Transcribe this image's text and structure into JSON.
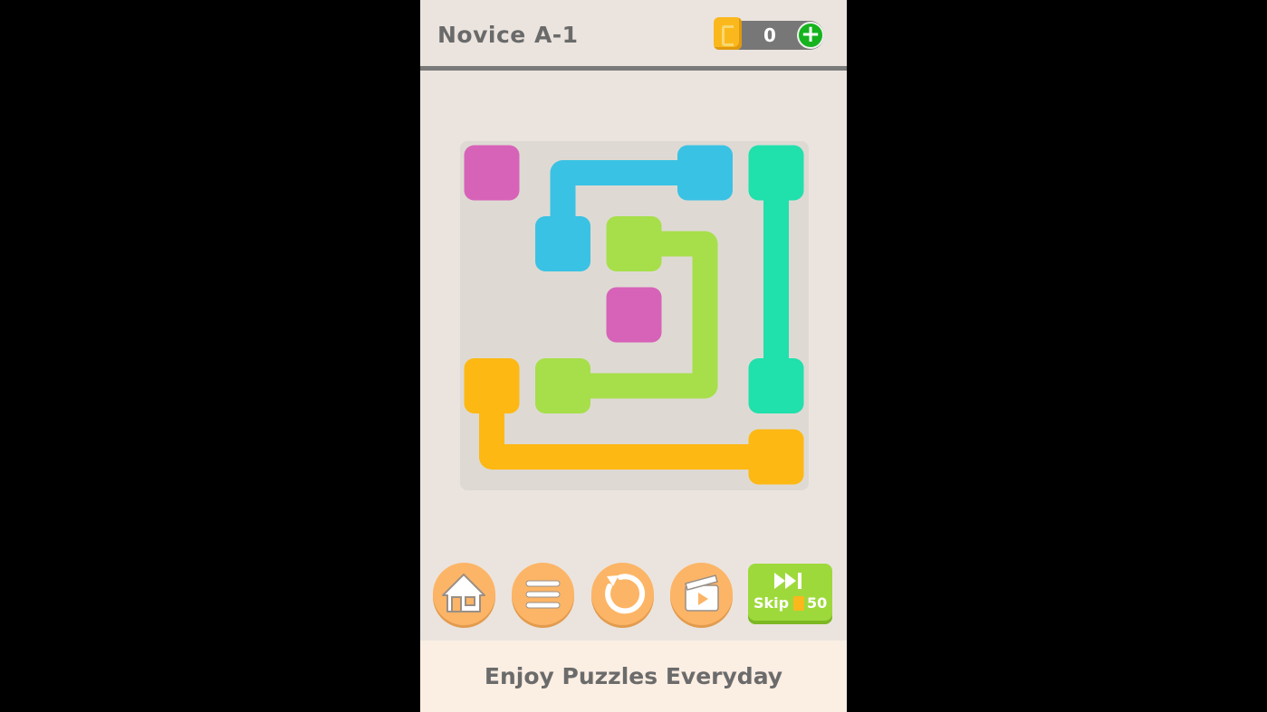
{
  "header": {
    "level_title": "Novice A-1",
    "coin_count": "0",
    "add_coins_symbol": "+"
  },
  "board": {
    "grid_size": 5,
    "colors": {
      "pink": "#d763b8",
      "blue": "#3ac2e4",
      "teal": "#20e0ac",
      "green": "#a6df4a",
      "orange": "#fdb813"
    },
    "endpoints": [
      {
        "color": "pink",
        "row": 0,
        "col": 0
      },
      {
        "color": "pink",
        "row": 2,
        "col": 2
      },
      {
        "color": "blue",
        "row": 0,
        "col": 3
      },
      {
        "color": "blue",
        "row": 1,
        "col": 1
      },
      {
        "color": "teal",
        "row": 0,
        "col": 4
      },
      {
        "color": "teal",
        "row": 3,
        "col": 4
      },
      {
        "color": "green",
        "row": 1,
        "col": 2
      },
      {
        "color": "green",
        "row": 3,
        "col": 1
      },
      {
        "color": "orange",
        "row": 3,
        "col": 0
      },
      {
        "color": "orange",
        "row": 4,
        "col": 4
      }
    ],
    "paths": [
      {
        "color": "blue",
        "cells": [
          [
            0,
            3
          ],
          [
            0,
            1
          ],
          [
            1,
            1
          ]
        ]
      },
      {
        "color": "teal",
        "cells": [
          [
            0,
            4
          ],
          [
            3,
            4
          ]
        ]
      },
      {
        "color": "green",
        "cells": [
          [
            1,
            2
          ],
          [
            1,
            3
          ],
          [
            3,
            3
          ],
          [
            3,
            1
          ]
        ]
      },
      {
        "color": "orange",
        "cells": [
          [
            3,
            0
          ],
          [
            4,
            0
          ],
          [
            4,
            4
          ]
        ]
      }
    ]
  },
  "controls": {
    "home_icon": "home-icon",
    "menu_icon": "hamburger-menu-icon",
    "restart_icon": "restart-icon",
    "video_icon": "video-clapper-icon",
    "skip_label": "Skip",
    "skip_cost": "50"
  },
  "footer": {
    "tagline": "Enjoy Puzzles Everyday"
  }
}
